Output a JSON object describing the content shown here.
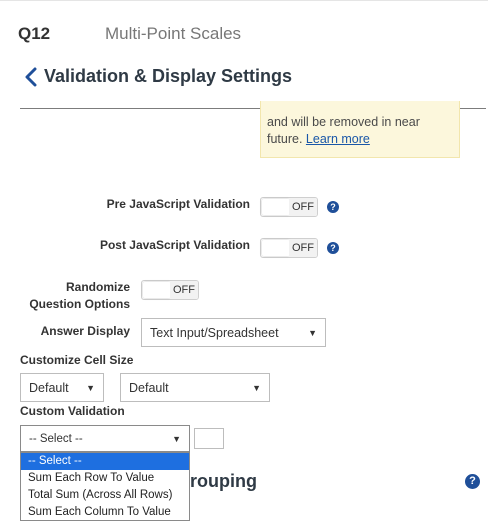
{
  "header": {
    "question_number": "Q12",
    "question_title": "Multi-Point Scales"
  },
  "section": {
    "title": "Validation & Display Settings"
  },
  "notice": {
    "text": "and will be removed in near future.",
    "link": "Learn more"
  },
  "settings": {
    "pre_js": {
      "label": "Pre JavaScript Validation",
      "state": "OFF"
    },
    "post_js": {
      "label": "Post JavaScript Validation",
      "state": "OFF"
    },
    "randomize": {
      "label_line1": "Randomize",
      "label_line2": "Question Options",
      "state": "OFF"
    },
    "answer_display": {
      "label": "Answer Display",
      "value": "Text Input/Spreadsheet"
    },
    "cell_size": {
      "label": "Customize Cell Size",
      "width_value": "Default",
      "height_value": "Default"
    },
    "custom_validation": {
      "label": "Custom Validation",
      "value": "-- Select --",
      "options": [
        "-- Select --",
        "Sum Each Row To Value",
        "Total Sum (Across All Rows)",
        "Sum Each Column To Value"
      ],
      "selected_index": 0
    }
  },
  "grouping": {
    "partial_title": "rouping"
  },
  "icons": {
    "help": "question-circle-icon",
    "back": "chevron-left-icon"
  },
  "colors": {
    "accent": "#1f4f99",
    "selected_option": "#1e6fe0",
    "notice_bg": "#fcf7dc",
    "link": "#1a57a8"
  }
}
